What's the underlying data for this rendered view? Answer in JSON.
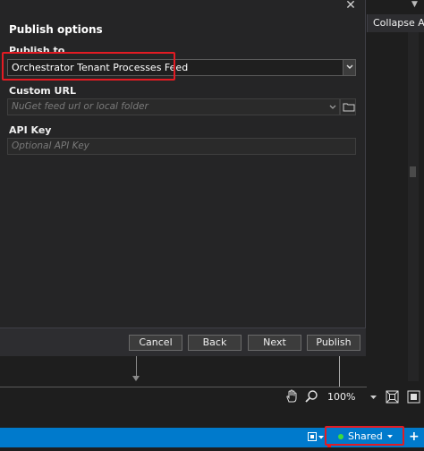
{
  "dialog": {
    "title": "Publish options",
    "publish_to": {
      "label": "Publish to",
      "value": "Orchestrator Tenant Processes Feed"
    },
    "custom_url": {
      "label": "Custom URL",
      "placeholder": "NuGet feed url or local folder"
    },
    "api_key": {
      "label": "API Key",
      "placeholder": "Optional API Key"
    },
    "buttons": {
      "cancel": "Cancel",
      "back": "Back",
      "next": "Next",
      "publish": "Publish"
    }
  },
  "right_panel": {
    "collapse_all": "Collapse All"
  },
  "zoom": {
    "level": "100%"
  },
  "status_bar": {
    "shared": "Shared"
  },
  "colors": {
    "status_bar": "#007acc",
    "highlight": "#e31b23",
    "online_dot": "#3ddc3d"
  }
}
